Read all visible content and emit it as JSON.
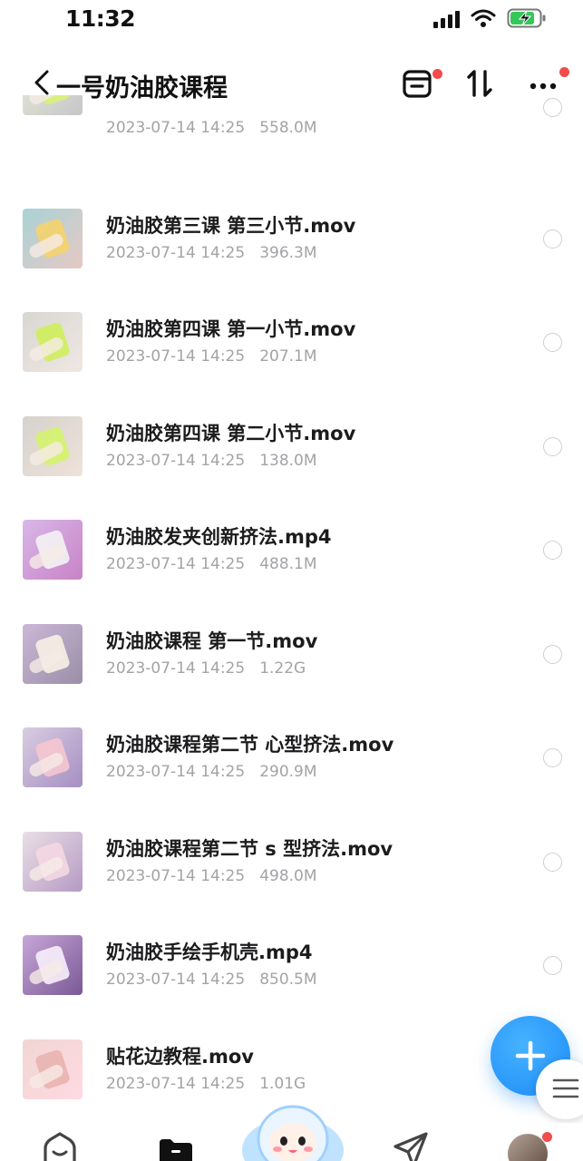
{
  "status_bar": {
    "time": "11:32",
    "icons": [
      "signal-icon",
      "wifi-icon",
      "battery-charging-icon"
    ]
  },
  "nav": {
    "back_icon": "chevron-left-icon",
    "title": "一号奶油胶课程",
    "actions": [
      "transfer-list-icon",
      "sort-icon",
      "more-icon"
    ]
  },
  "files": [
    {
      "name": "",
      "date": "2023-07-14 14:25",
      "size": "558.0M"
    },
    {
      "name": "奶油胶第三课 第三小节.mov",
      "date": "2023-07-14 14:25",
      "size": "396.3M"
    },
    {
      "name": "奶油胶第四课 第一小节.mov",
      "date": "2023-07-14 14:25",
      "size": "207.1M"
    },
    {
      "name": "奶油胶第四课 第二小节.mov",
      "date": "2023-07-14 14:25",
      "size": "138.0M"
    },
    {
      "name": "奶油胶发夹创新挤法.mp4",
      "date": "2023-07-14 14:25",
      "size": "488.1M"
    },
    {
      "name": "奶油胶课程 第一节.mov",
      "date": "2023-07-14 14:25",
      "size": "1.22G"
    },
    {
      "name": "奶油胶课程第二节 心型挤法.mov",
      "date": "2023-07-14 14:25",
      "size": "290.9M"
    },
    {
      "name": "奶油胶课程第二节 s 型挤法.mov",
      "date": "2023-07-14 14:25",
      "size": "498.0M"
    },
    {
      "name": "奶油胶手绘手机壳.mp4",
      "date": "2023-07-14 14:25",
      "size": "850.5M"
    },
    {
      "name": "贴花边教程.mov",
      "date": "2023-07-14 14:25",
      "size": "1.01G"
    }
  ],
  "fab": {
    "icon": "plus-icon"
  },
  "side_menu": {
    "icon": "menu-icon"
  },
  "tab_bar": {
    "tabs": [
      "home-icon",
      "files-icon",
      "mascot-icon",
      "send-icon",
      "profile-avatar"
    ]
  },
  "colors": {
    "accent": "#1d8cf8",
    "badge": "#f24b4b",
    "meta_text": "#a3a3a8",
    "title_text": "#1c1c1e"
  }
}
